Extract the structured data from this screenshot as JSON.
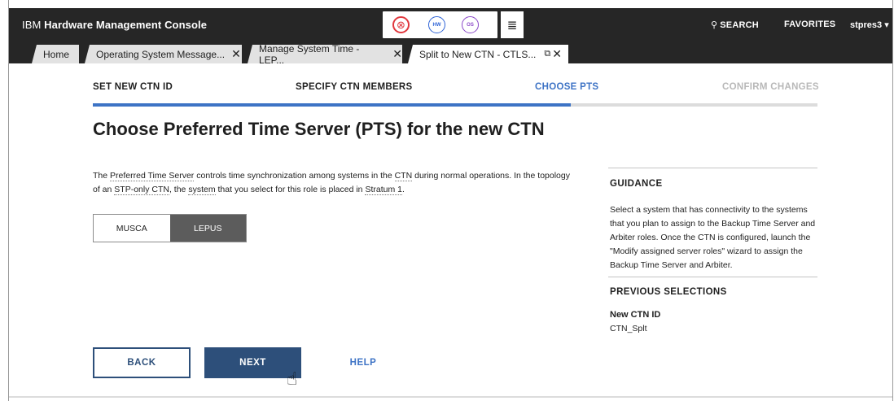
{
  "header": {
    "brand_prefix": "IBM",
    "brand_name": "Hardware Management Console",
    "status_icons": [
      {
        "name": "error-status-icon",
        "glyph": "⊗",
        "color": "#e0373d"
      },
      {
        "name": "hardware-status-icon",
        "glyph": "HW",
        "color": "#2e63d6"
      },
      {
        "name": "os-status-icon",
        "glyph": "OS",
        "color": "#8a47c8"
      }
    ],
    "tasks_icon": "task-list-icon",
    "search_label": "SEARCH",
    "favorites_label": "FAVORITES",
    "user_label": "stpres3 ▾"
  },
  "tabs": [
    {
      "label": "Home",
      "closable": false
    },
    {
      "label": "Operating System Message...",
      "closable": true
    },
    {
      "label": "Manage System Time - LEP...",
      "closable": true
    },
    {
      "label": "Split to New CTN - CTLS...",
      "closable": true,
      "active": true
    }
  ],
  "wizard": {
    "steps": [
      {
        "label": "SET NEW CTN ID",
        "state": "done"
      },
      {
        "label": "SPECIFY CTN MEMBERS",
        "state": "done"
      },
      {
        "label": "CHOOSE PTS",
        "state": "current"
      },
      {
        "label": "CONFIRM CHANGES",
        "state": "pending"
      }
    ],
    "progress_fraction": 0.66
  },
  "main": {
    "title": "Choose Preferred Time Server (PTS) for the new CTN",
    "description": {
      "p1": "The ",
      "term_pts": "Preferred Time Server",
      "p2": " controls time synchronization among systems in the ",
      "term_ctn": "CTN",
      "p3": " during normal operations. In the topology of an ",
      "term_stp": "STP-only CTN",
      "p4": ", the ",
      "term_system": "system",
      "p5": " that you select for this role is placed in ",
      "term_stratum": "Stratum 1",
      "p6": "."
    },
    "systems": [
      {
        "label": "MUSCA",
        "selected": false
      },
      {
        "label": "LEPUS",
        "selected": true
      }
    ]
  },
  "guidance": {
    "heading": "GUIDANCE",
    "text": "Select a system that has connectivity to the systems that you plan to assign to the Backup Time Server and Arbiter roles. Once the CTN is configured, launch the \"Modify assigned server roles\" wizard to assign the Backup Time Server and Arbiter.",
    "previous_heading": "PREVIOUS SELECTIONS",
    "ctn_id_label": "New CTN ID",
    "ctn_id_value": "CTN_Splt"
  },
  "buttons": {
    "back": "BACK",
    "next": "NEXT",
    "help": "HELP"
  },
  "colors": {
    "accent": "#3d73c5",
    "primary_button": "#2d4f7a",
    "header_bg": "#262626",
    "selected_segment": "#5c5c5c"
  }
}
